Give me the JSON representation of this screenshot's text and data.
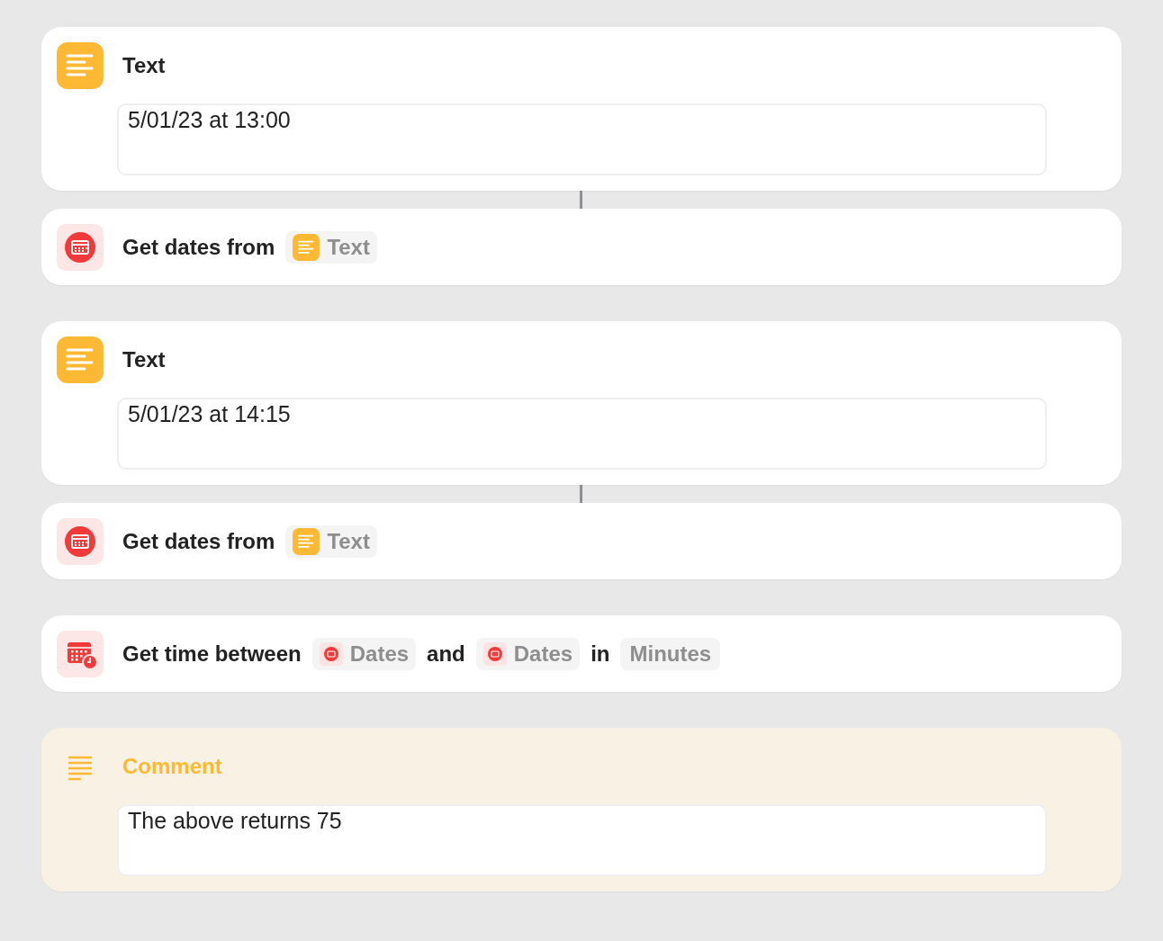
{
  "actions": [
    {
      "kind": "text",
      "linked": false,
      "title": "Text",
      "value": "5/01/23 at 13:00"
    },
    {
      "kind": "get_dates",
      "linked": true,
      "parts": [
        {
          "kind": "label",
          "text": "Get dates from"
        },
        {
          "kind": "text_variable",
          "text": "Text"
        }
      ]
    },
    {
      "kind": "text",
      "linked": false,
      "title": "Text",
      "value": "5/01/23 at 14:15"
    },
    {
      "kind": "get_dates",
      "linked": true,
      "parts": [
        {
          "kind": "label",
          "text": "Get dates from"
        },
        {
          "kind": "text_variable",
          "text": "Text"
        }
      ]
    },
    {
      "kind": "time_between",
      "linked": false,
      "parts": [
        {
          "kind": "label",
          "text": "Get time between"
        },
        {
          "kind": "dates_variable",
          "text": "Dates"
        },
        {
          "kind": "label",
          "text": "and"
        },
        {
          "kind": "dates_variable",
          "text": "Dates"
        },
        {
          "kind": "label",
          "text": "in"
        },
        {
          "kind": "parameter",
          "text": "Minutes"
        }
      ]
    },
    {
      "kind": "comment",
      "linked": false,
      "title": "Comment",
      "value": "The above returns 75"
    }
  ]
}
